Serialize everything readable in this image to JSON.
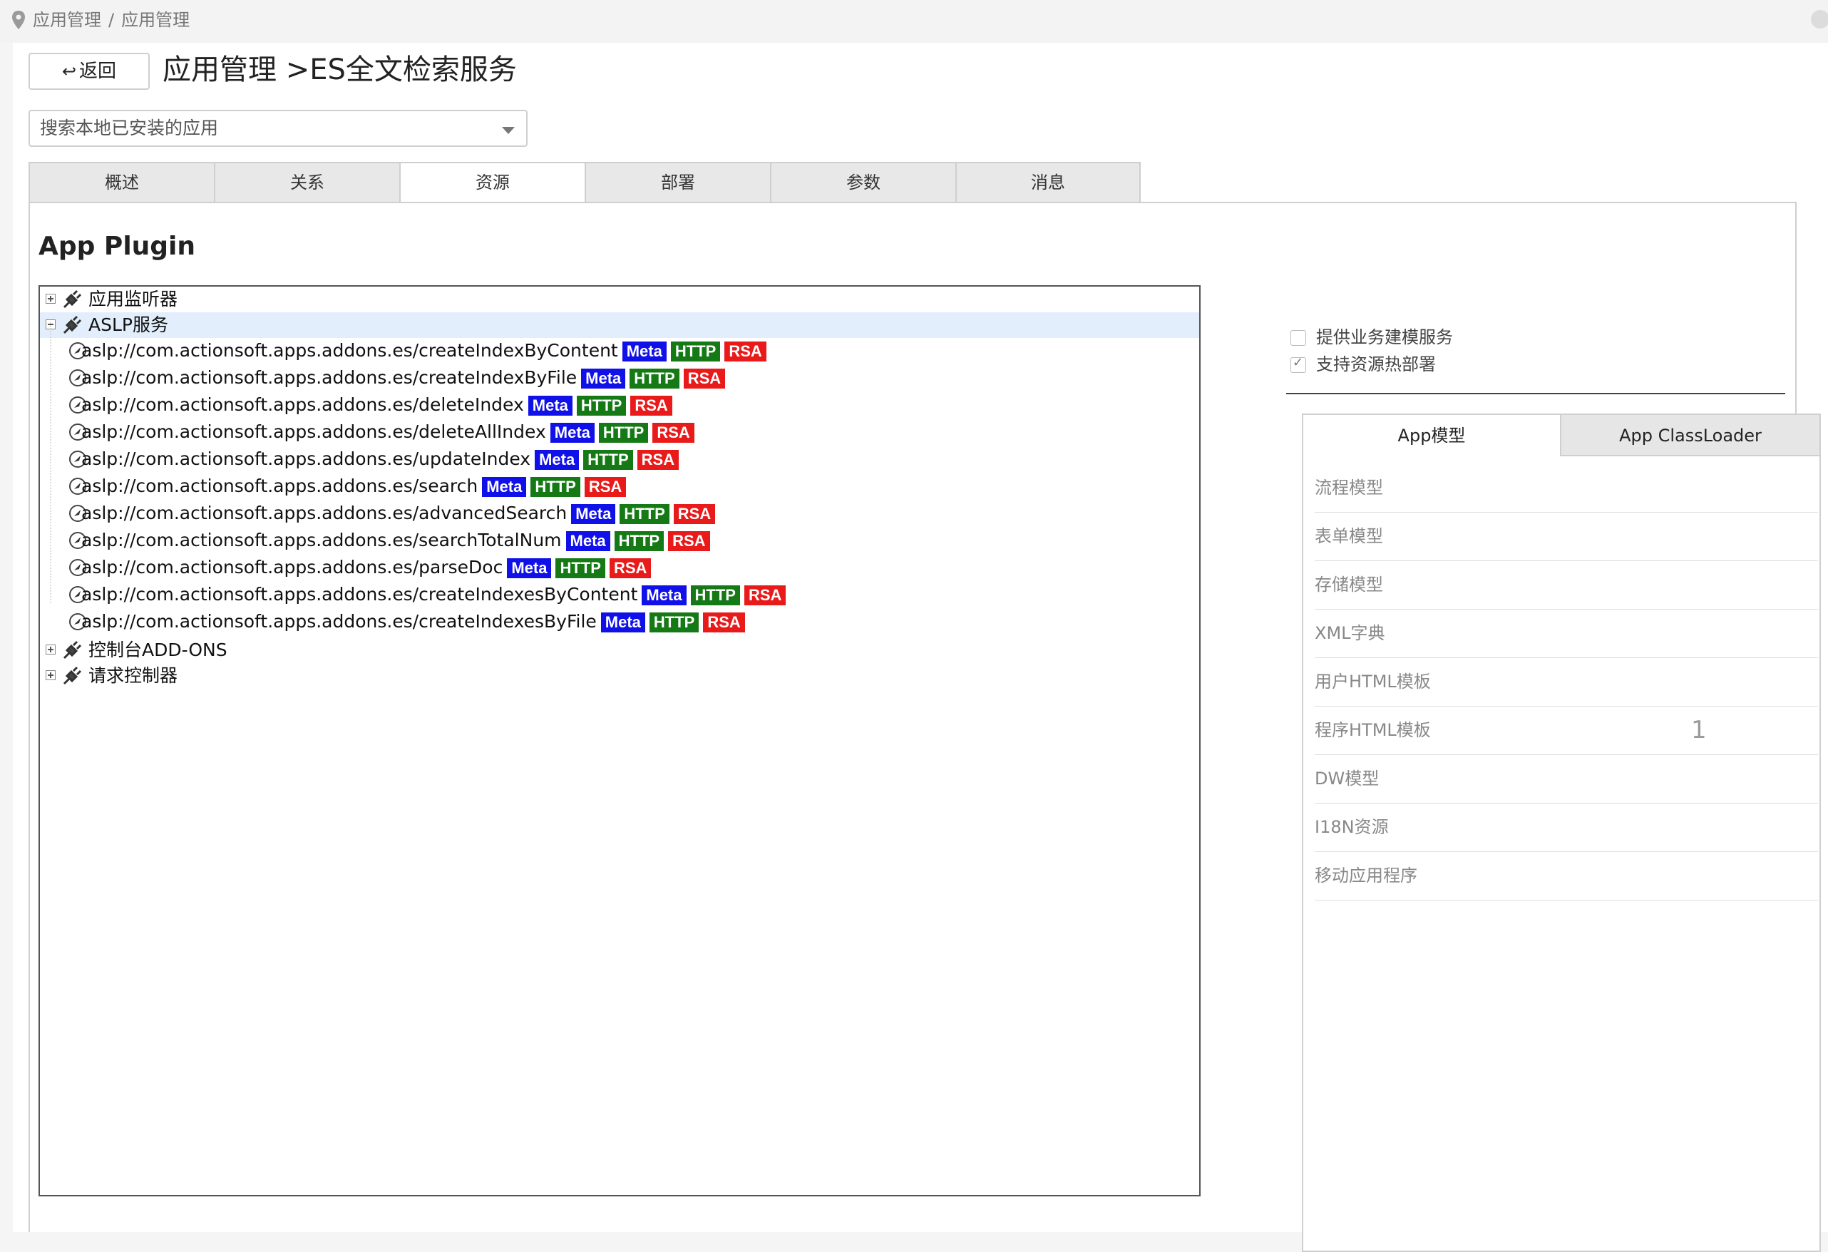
{
  "breadcrumb": {
    "items": [
      "应用管理",
      "应用管理"
    ],
    "separator": "/"
  },
  "header": {
    "back_label": "返回",
    "back_icon": "return-arrow-icon",
    "title": "应用管理 >ES全文检索服务"
  },
  "search": {
    "placeholder": "搜索本地已安装的应用"
  },
  "tabs": [
    {
      "label": "概述",
      "active": false
    },
    {
      "label": "关系",
      "active": false
    },
    {
      "label": "资源",
      "active": true
    },
    {
      "label": "部署",
      "active": false
    },
    {
      "label": "参数",
      "active": false
    },
    {
      "label": "消息",
      "active": false
    }
  ],
  "section_title": "App Plugin",
  "tree": {
    "nodes": [
      {
        "label": "应用监听器",
        "expanded": false
      },
      {
        "label": "ASLP服务",
        "expanded": true,
        "selected": true
      },
      {
        "label": "控制台ADD-ONS",
        "expanded": false
      },
      {
        "label": "请求控制器",
        "expanded": false
      }
    ],
    "children": [
      "aslp://com.actionsoft.apps.addons.es/createIndexByContent",
      "aslp://com.actionsoft.apps.addons.es/createIndexByFile",
      "aslp://com.actionsoft.apps.addons.es/deleteIndex",
      "aslp://com.actionsoft.apps.addons.es/deleteAllIndex",
      "aslp://com.actionsoft.apps.addons.es/updateIndex",
      "aslp://com.actionsoft.apps.addons.es/search",
      "aslp://com.actionsoft.apps.addons.es/advancedSearch",
      "aslp://com.actionsoft.apps.addons.es/searchTotalNum",
      "aslp://com.actionsoft.apps.addons.es/parseDoc",
      "aslp://com.actionsoft.apps.addons.es/createIndexesByContent",
      "aslp://com.actionsoft.apps.addons.es/createIndexesByFile"
    ],
    "badges": {
      "meta": "Meta",
      "http": "HTTP",
      "rsa": "RSA"
    },
    "badge_colors": {
      "meta": "#1010e8",
      "http": "#157a15",
      "rsa": "#e81a1a"
    }
  },
  "options": [
    {
      "label": "提供业务建模服务",
      "checked": false
    },
    {
      "label": "支持资源热部署",
      "checked": true
    }
  ],
  "model_panel": {
    "tabs": [
      "App模型",
      "App ClassLoader"
    ],
    "rows": [
      "流程模型",
      "表单模型",
      "存储模型",
      "XML字典",
      "用户HTML模板",
      "程序HTML模板",
      "DW模型",
      "I18N资源",
      "移动应用程序"
    ],
    "count_row": "程序HTML模板",
    "count": "1"
  }
}
